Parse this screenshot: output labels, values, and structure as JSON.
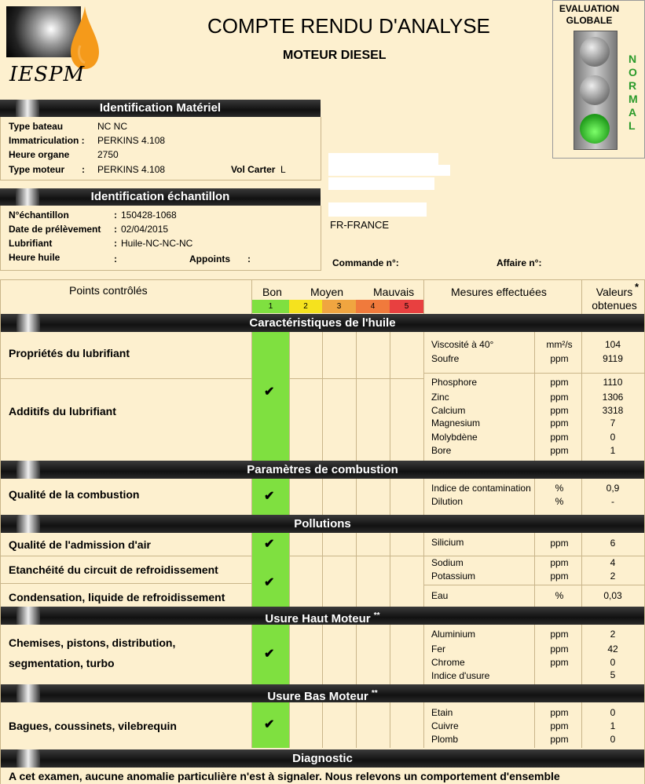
{
  "header": {
    "logo_text": "IESPM",
    "title": "COMPTE RENDU D'ANALYSE",
    "subtitle": "MOTEUR DIESEL",
    "eval_label": "EVALUATION GLOBALE",
    "eval_status": "NORMAL"
  },
  "materiel": {
    "title": "Identification Matériel",
    "type_bateau_label": "Type bateau",
    "type_bateau": "NC NC",
    "immat_label": "Immatriculation :",
    "immat": "PERKINS 4.108",
    "heure_organe_label": "Heure organe",
    "heure_organe": "2750",
    "type_moteur_label": "Type moteur",
    "type_moteur": "PERKINS 4.108",
    "vol_carter_label": "Vol Carter",
    "vol_carter_unit": "L"
  },
  "echantillon": {
    "title": "Identification échantillon",
    "num_label": "N°échantillon",
    "num": "150428-1068",
    "date_label": "Date de prélèvement",
    "date": "02/04/2015",
    "lub_label": "Lubrifiant",
    "lub": "Huile-NC-NC-NC",
    "heure_huile_label": "Heure huile",
    "appoints_label": "Appoints"
  },
  "client": {
    "country": "FR-FRANCE",
    "commande_label": "Commande n°:",
    "affaire_label": "Affaire n°:"
  },
  "table_header": {
    "points": "Points contrôlés",
    "bon": "Bon",
    "moyen": "Moyen",
    "mauvais": "Mauvais",
    "scale": [
      "1",
      "2",
      "3",
      "4",
      "5"
    ],
    "mesures": "Mesures effectuées",
    "valeurs": "Valeurs obtenues",
    "star": "*"
  },
  "sections": {
    "caracteristiques": "Caractéristiques de l'huile",
    "combustion": "Paramètres de combustion",
    "pollutions": "Pollutions",
    "haut": "Usure Haut Moteur",
    "bas": "Usure Bas Moteur",
    "diagnostic": "Diagnostic",
    "stars": "**"
  },
  "points": {
    "proprietes": "Propriétés du lubrifiant",
    "additifs": "Additifs du lubrifiant",
    "qualite_comb": "Qualité de la combustion",
    "admission": "Qualité de l'admission d'air",
    "etancheite": "Etanchéité du circuit de refroidissement",
    "condensation": "Condensation, liquide de refroidissement",
    "chemises1": "Chemises, pistons, distribution,",
    "chemises2": "segmentation, turbo",
    "bagues": "Bagues, coussinets, vilebrequin"
  },
  "check": "✔",
  "measures": {
    "visc": {
      "name": "Viscosité à 40°",
      "unit": "mm²/s",
      "value": "104"
    },
    "soufre": {
      "name": "Soufre",
      "unit": "ppm",
      "value": "9119"
    },
    "phos": {
      "name": "Phosphore",
      "unit": "ppm",
      "value": "1110"
    },
    "zinc": {
      "name": "Zinc",
      "unit": "ppm",
      "value": "1306"
    },
    "calcium": {
      "name": "Calcium",
      "unit": "ppm",
      "value": "3318"
    },
    "magnesium": {
      "name": "Magnesium",
      "unit": "ppm",
      "value": "7"
    },
    "molyb": {
      "name": "Molybdène",
      "unit": "ppm",
      "value": "0"
    },
    "bore": {
      "name": "Bore",
      "unit": "ppm",
      "value": "1"
    },
    "contam": {
      "name": "Indice de contamination",
      "unit": "%",
      "value": "0,9"
    },
    "dilution": {
      "name": "Dilution",
      "unit": "%",
      "value": "-"
    },
    "silicium": {
      "name": "Silicium",
      "unit": "ppm",
      "value": "6"
    },
    "sodium": {
      "name": "Sodium",
      "unit": "ppm",
      "value": "4"
    },
    "potassium": {
      "name": "Potassium",
      "unit": "ppm",
      "value": "2"
    },
    "eau": {
      "name": "Eau",
      "unit": "%",
      "value": "0,03"
    },
    "alu": {
      "name": "Aluminium",
      "unit": "ppm",
      "value": "2"
    },
    "fer": {
      "name": "Fer",
      "unit": "ppm",
      "value": "42"
    },
    "chrome": {
      "name": "Chrome",
      "unit": "ppm",
      "value": "0"
    },
    "usure": {
      "name": "Indice d'usure",
      "unit": "",
      "value": "5"
    },
    "etain": {
      "name": "Etain",
      "unit": "ppm",
      "value": "0"
    },
    "cuivre": {
      "name": "Cuivre",
      "unit": "ppm",
      "value": "1"
    },
    "plomb": {
      "name": "Plomb",
      "unit": "ppm",
      "value": "0"
    }
  },
  "diagnostic_text": "A cet examen, aucune anomalie particulière n'est à signaler. Nous relevons un comportement d'ensemble",
  "colors": {
    "green": "#7fe040",
    "yellow": "#f5e21e",
    "orange": "#f0a540",
    "dark_orange": "#f07a3c",
    "red": "#e84040"
  }
}
